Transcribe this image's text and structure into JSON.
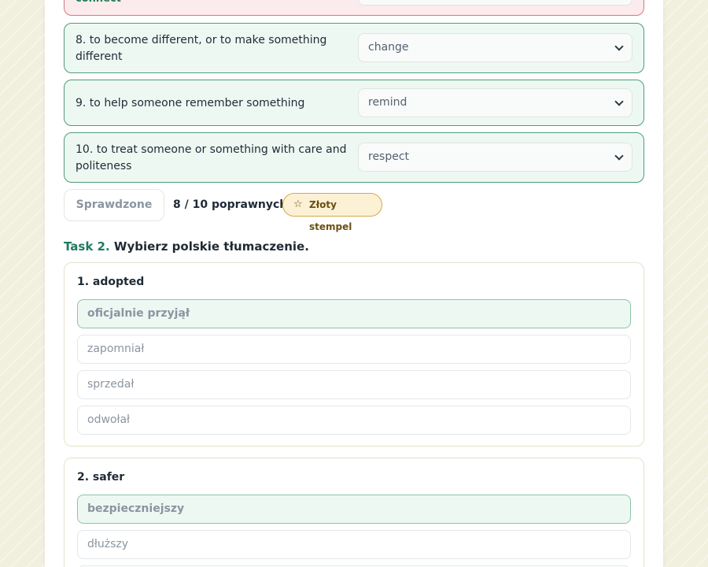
{
  "task1": {
    "prev_word": "connect",
    "rows": [
      {
        "question": "8. to become different, or to make something different",
        "selected": "change"
      },
      {
        "question": "9. to help someone remember something",
        "selected": "remind"
      },
      {
        "question": "10. to treat someone or something with care and politeness",
        "selected": "respect"
      }
    ],
    "checked_label": "Sprawdzone",
    "score_text": "8 / 10 poprawnych",
    "badge_label": "Złoty stempel",
    "badge_icon": "star-icon"
  },
  "task2": {
    "label": "Task 2.",
    "instruction": "Wybierz polskie tłumaczenie.",
    "questions": [
      {
        "head": "1. adopted",
        "options": [
          "oficjalnie przyjął",
          "zapomniał",
          "sprzedał",
          "odwołał"
        ],
        "correct_index": 0
      },
      {
        "head": "2. safer",
        "options": [
          "bezpieczniejszy",
          "dłuższy"
        ],
        "correct_index": 0
      }
    ]
  },
  "colors": {
    "correct_border": "#4d9d79",
    "correct_bg": "#eef8f2",
    "wrong_border": "#d97784",
    "wrong_bg": "#fbebec",
    "badge_bg": "#fcf1d5",
    "accent": "#1f7a62"
  }
}
